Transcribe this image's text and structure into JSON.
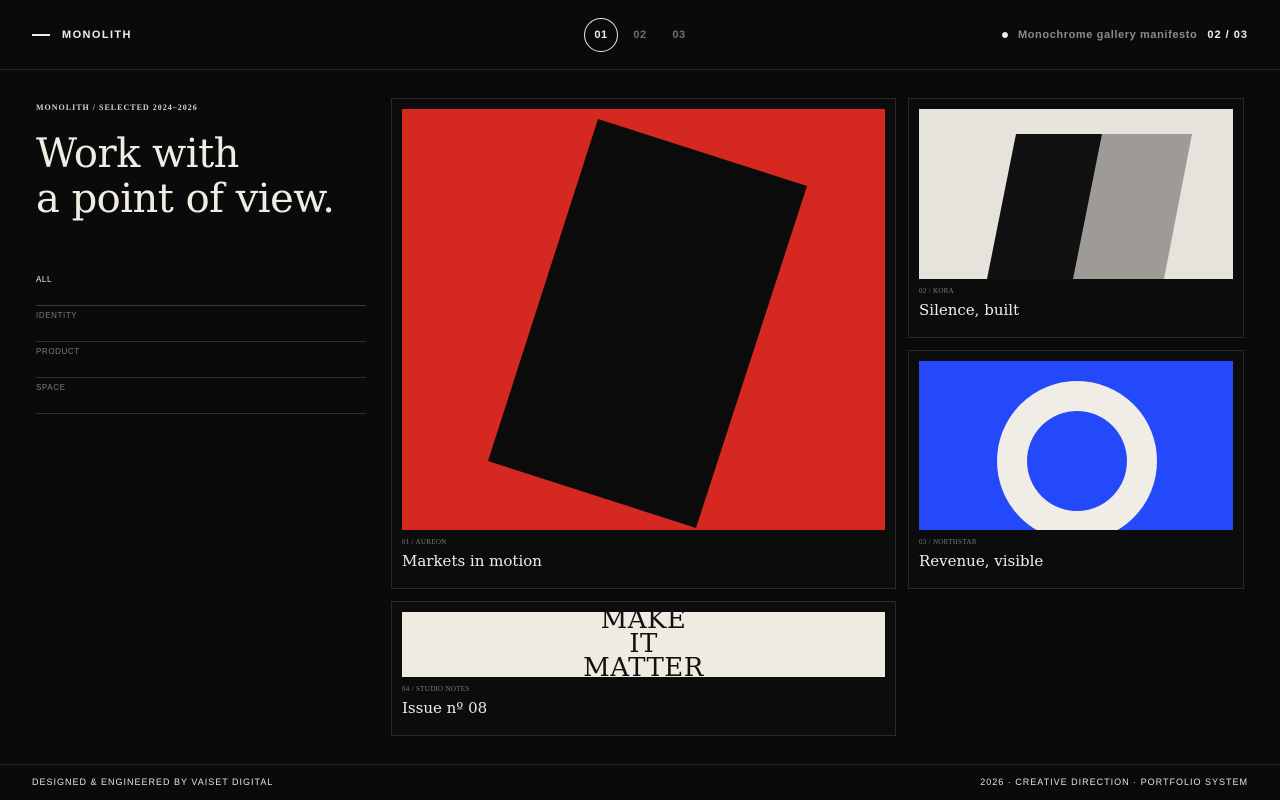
{
  "header": {
    "brand": "MONOLITH",
    "pager": [
      "01",
      "02",
      "03"
    ],
    "pager_active": 0,
    "status_text": "Monochrome gallery manifesto",
    "status_count": "02 / 03"
  },
  "sidebar": {
    "eyebrow": "MONOLITH / SELECTED 2024–2026",
    "headline_line1": "Work with",
    "headline_line2": "a point of view.",
    "filters": [
      {
        "label": "ALL",
        "active": true
      },
      {
        "label": "IDENTITY",
        "active": false
      },
      {
        "label": "PRODUCT",
        "active": false
      },
      {
        "label": "SPACE",
        "active": false
      }
    ]
  },
  "cards": [
    {
      "meta": "01 / AUREON",
      "title": "Markets in motion",
      "image": "black-slab-on-red",
      "bg": "#d42820"
    },
    {
      "meta": "02 / KORA",
      "title": "Silence, built",
      "image": "parallelograms-on-cream",
      "bg": "#e6e2dc"
    },
    {
      "meta": "03 / NORTHSTAR",
      "title": "Revenue, visible",
      "image": "ring-on-blue",
      "bg": "#2449fb"
    },
    {
      "meta": "04 / STUDIO NOTES",
      "title": "Issue nº 08",
      "image": "type-poster",
      "bg": "#f0ebe1",
      "poster_lines": [
        "MAKE",
        "IT",
        "MATTER"
      ]
    }
  ],
  "footer": {
    "left": "DESIGNED & ENGINEERED BY VAISET DIGITAL",
    "right": "2026 · CREATIVE DIRECTION · PORTFOLIO SYSTEM"
  },
  "colors": {
    "background": "#0a0a0a",
    "text": "#f0ece4",
    "accent_red": "#d42820",
    "accent_blue": "#2449fb"
  }
}
